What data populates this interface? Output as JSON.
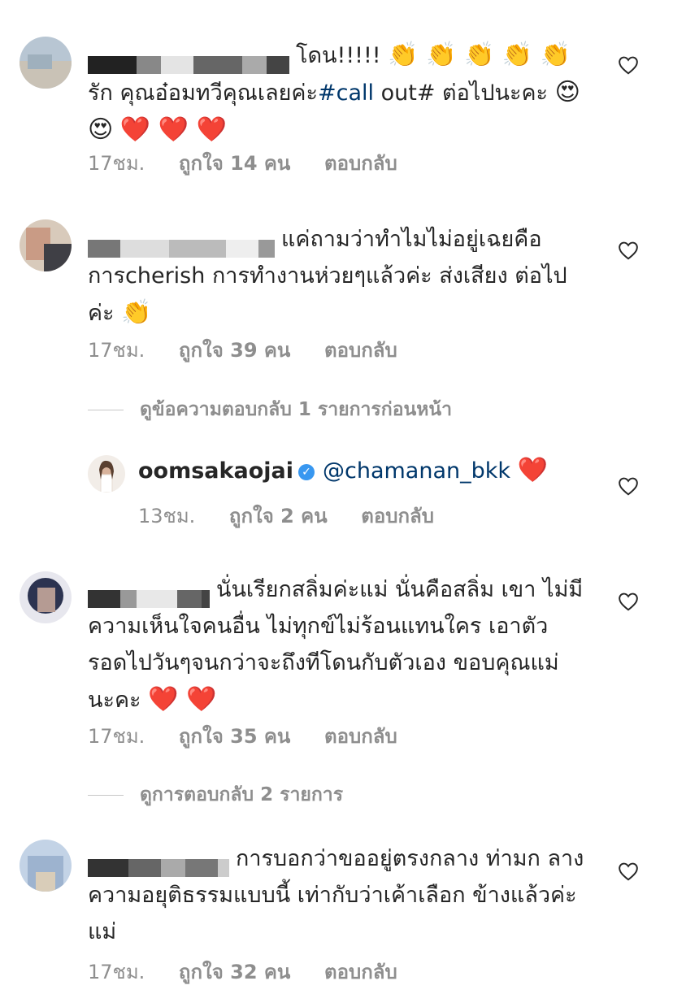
{
  "comments": [
    {
      "text_before": "โดน!!!!!",
      "emojis_a": "👏 👏 👏 👏 👏",
      "text_mid": " รัก คุณอ๋อมทวีคุณเลยค่ะ",
      "hashtag": "#call",
      "text_after": " out# ต่อไปนะคะ",
      "emojis_b": "😍 😍",
      "hearts": "❤️ ❤️ ❤️",
      "time": "17ชม.",
      "likes": "ถูกใจ 14 คน",
      "reply": "ตอบกลับ"
    },
    {
      "text": "แค่ถามว่าทำไมไม่อยู่เฉยคือ การcherish การทำงานห่วยๆแล้วค่ะ ส่งเสียง ต่อไปค่ะ",
      "emojis": "👏",
      "time": "17ชม.",
      "likes": "ถูกใจ 39 คน",
      "reply": "ตอบกลับ"
    },
    {
      "text": "นั่นเรียกสลิ่มค่ะแม่ นั่นคือสลิ่ม เขา ไม่มีความเห็นใจคนอื่น ไม่ทุกข์ไม่ร้อนแทนใคร เอาตัวรอดไปวันๆจนกว่าจะถึงทีโดนกับตัวเอง ขอบคุณแม่นะคะ",
      "hearts": "❤️ ❤️",
      "time": "17ชม.",
      "likes": "ถูกใจ 35 คน",
      "reply": "ตอบกลับ"
    },
    {
      "text": "การบอกว่าขออยู่ตรงกลาง ท่ามก ลางความอยุติธรรมแบบนี้ เท่ากับว่าเค้าเลือก ข้างแล้วค่ะแม่",
      "time": "17ชม.",
      "likes": "ถูกใจ 32 คน",
      "reply": "ตอบกลับ"
    }
  ],
  "view_previous": "ดูข้อความตอบกลับ 1 รายการก่อนหน้า",
  "reply_item": {
    "username": "oomsakaojai",
    "mention": "@chamanan_bkk",
    "heart": "❤️",
    "time": "13ชม.",
    "likes": "ถูกใจ 2 คน",
    "reply": "ตอบกลับ"
  },
  "view_replies": "ดูการตอบกลับ 2 รายการ",
  "colors": {
    "meta": "#8e8e8e",
    "link": "#00376b",
    "verified": "#3897f0",
    "heart": "#e0101e"
  },
  "icons": {
    "like": "heart-outline-icon",
    "verified": "verified-badge-icon"
  }
}
